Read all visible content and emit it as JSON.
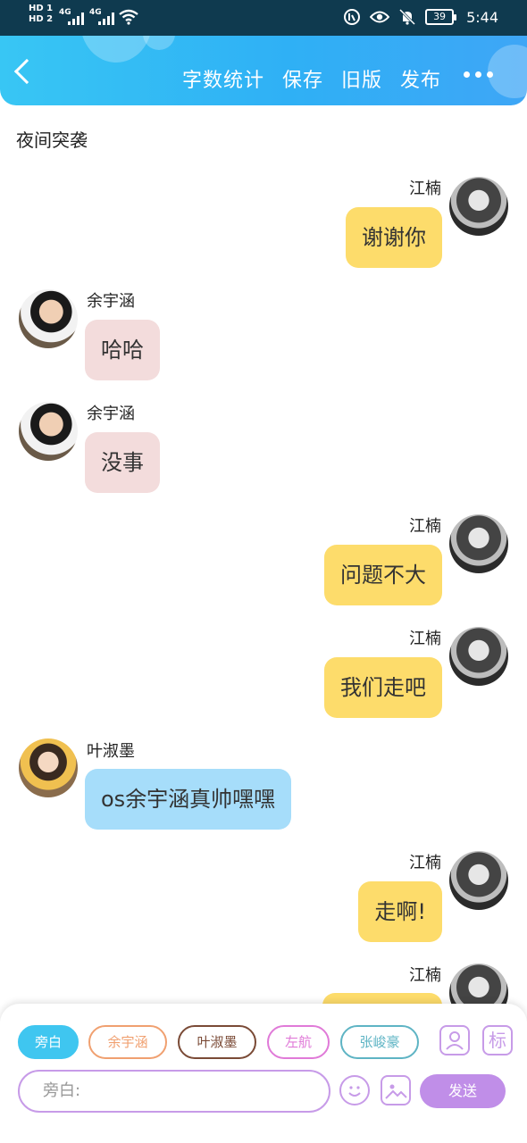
{
  "status": {
    "sim1": "HD 1",
    "sim2": "HD 2",
    "net1": "4G",
    "net2": "4G",
    "battery": "39",
    "time": "5:44"
  },
  "header": {
    "actions": [
      "字数统计",
      "保存",
      "旧版",
      "发布"
    ]
  },
  "chat_title": "夜间突袭",
  "messages": [
    {
      "name": "江楠",
      "text": "谢谢你"
    },
    {
      "name": "余宇涵",
      "text": "哈哈"
    },
    {
      "name": "余宇涵",
      "text": "没事"
    },
    {
      "name": "江楠",
      "text": "问题不大"
    },
    {
      "name": "江楠",
      "text": "我们走吧"
    },
    {
      "name": "叶淑墨",
      "text": "os余宇涵真帅嘿嘿"
    },
    {
      "name": "江楠",
      "text": "走啊!"
    },
    {
      "name": "江楠",
      "text": ""
    }
  ],
  "roles": [
    {
      "label": "旁白",
      "color": "#3fc6f0"
    },
    {
      "label": "余宇涵",
      "color": "#f0a070"
    },
    {
      "label": "叶淑墨",
      "color": "#7a4a36"
    },
    {
      "label": "左航",
      "color": "#e07ad8"
    },
    {
      "label": "张峻豪",
      "color": "#5eb4c4"
    }
  ],
  "icons": {
    "role_icon": "person-icon",
    "tag_icon_text": "标"
  },
  "input": {
    "placeholder": "旁白:"
  },
  "send_label": "发送"
}
